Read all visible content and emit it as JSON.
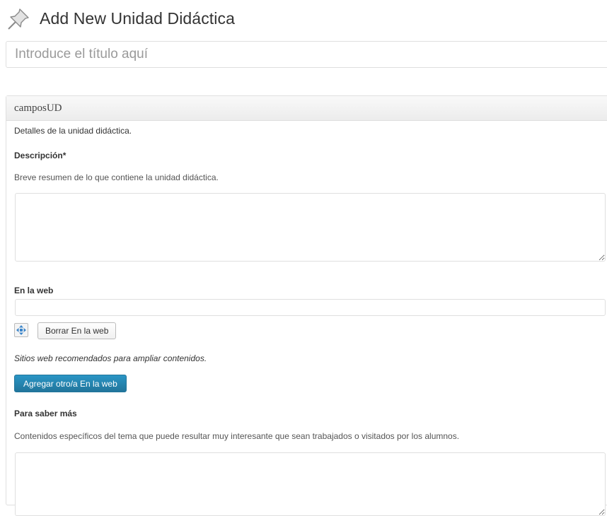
{
  "header": {
    "title": "Add New Unidad Didáctica",
    "icon": "pin-icon"
  },
  "title_input": {
    "placeholder": "Introduce el título aquí",
    "value": ""
  },
  "metabox": {
    "title": "camposUD",
    "intro": "Detalles de la unidad didáctica.",
    "descripcion": {
      "label": "Descripción*",
      "help": "Breve resumen de lo que contiene la unidad didáctica.",
      "value": ""
    },
    "en_la_web": {
      "label": "En la web",
      "value": "",
      "delete_button": "Borrar En la web",
      "help": "Sitios web recomendados para ampliar contenidos.",
      "add_button": "Agregar otro/a En la web"
    },
    "para_saber_mas": {
      "label": "Para saber más",
      "help": "Contenidos específicos del tema que puede resultar muy interesante que sean trabajados o visitados por los alumnos.",
      "value": ""
    }
  },
  "colors": {
    "primary_button": "#21759b",
    "border": "#dfdfdf"
  }
}
